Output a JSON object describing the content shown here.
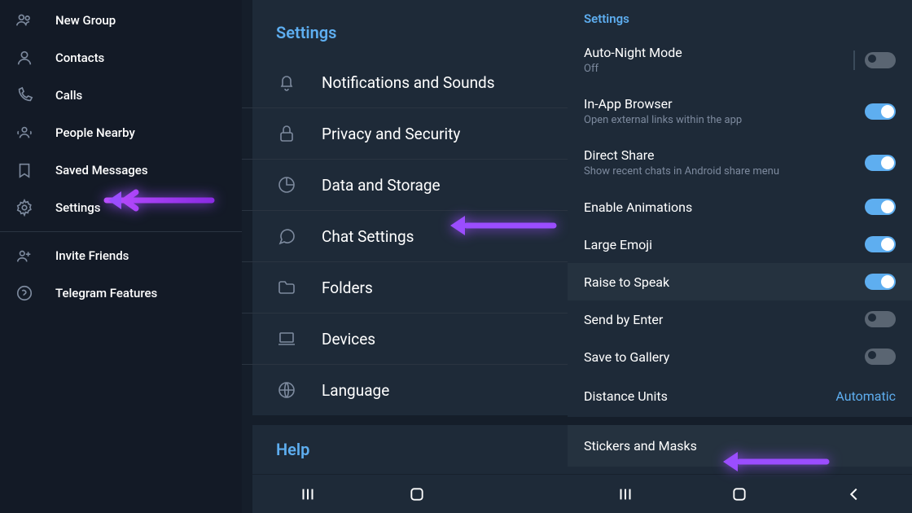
{
  "sidebar": {
    "items": [
      {
        "label": "New Group",
        "icon": "group"
      },
      {
        "label": "Contacts",
        "icon": "contact"
      },
      {
        "label": "Calls",
        "icon": "phone"
      },
      {
        "label": "People Nearby",
        "icon": "nearby"
      },
      {
        "label": "Saved Messages",
        "icon": "bookmark"
      },
      {
        "label": "Settings",
        "icon": "gear"
      }
    ],
    "footer_items": [
      {
        "label": "Invite Friends",
        "icon": "invite"
      },
      {
        "label": "Telegram Features",
        "icon": "help"
      }
    ]
  },
  "settings": {
    "header": "Settings",
    "items": [
      {
        "label": "Notifications and Sounds",
        "icon": "bell"
      },
      {
        "label": "Privacy and Security",
        "icon": "lock"
      },
      {
        "label": "Data and Storage",
        "icon": "pie"
      },
      {
        "label": "Chat Settings",
        "icon": "chat"
      },
      {
        "label": "Folders",
        "icon": "folder"
      },
      {
        "label": "Devices",
        "icon": "laptop"
      },
      {
        "label": "Language",
        "icon": "globe"
      }
    ],
    "help_header": "Help"
  },
  "chat_settings": {
    "header": "Settings",
    "rows": [
      {
        "title": "Auto-Night Mode",
        "subtitle": "Off",
        "on": false,
        "sep": true
      },
      {
        "title": "In-App Browser",
        "subtitle": "Open external links within the app",
        "on": true
      },
      {
        "title": "Direct Share",
        "subtitle": "Show recent chats in Android share menu",
        "on": true
      },
      {
        "title": "Enable Animations",
        "subtitle": "",
        "on": true
      },
      {
        "title": "Large Emoji",
        "subtitle": "",
        "on": true
      },
      {
        "title": "Raise to Speak",
        "subtitle": "",
        "on": true,
        "highlighted": true
      },
      {
        "title": "Send by Enter",
        "subtitle": "",
        "on": false
      },
      {
        "title": "Save to Gallery",
        "subtitle": "",
        "on": false
      }
    ],
    "distance_units": {
      "title": "Distance Units",
      "value": "Automatic"
    },
    "stickers": {
      "title": "Stickers and Masks"
    }
  }
}
